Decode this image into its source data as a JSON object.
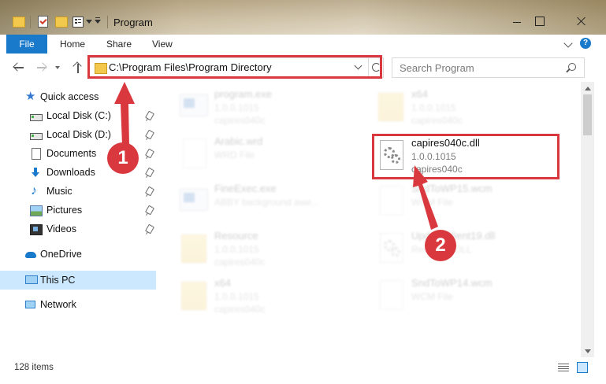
{
  "window": {
    "title": "Program"
  },
  "ribbon": {
    "tabs": [
      {
        "label": "File"
      },
      {
        "label": "Home"
      },
      {
        "label": "Share"
      },
      {
        "label": "View"
      }
    ],
    "help_label": "?"
  },
  "nav": {
    "address": "C:\\Program Files\\Program Directory",
    "search_placeholder": "Search Program"
  },
  "sidebar": {
    "items": [
      {
        "label": "Quick access",
        "icon": "star-icon"
      },
      {
        "label": "Local Disk (C:)",
        "icon": "drive-icon",
        "pinned": true
      },
      {
        "label": "Local Disk (D:)",
        "icon": "drive-icon",
        "pinned": true
      },
      {
        "label": "Documents",
        "icon": "documents-icon",
        "pinned": true
      },
      {
        "label": "Downloads",
        "icon": "download-icon",
        "pinned": true
      },
      {
        "label": "Music",
        "icon": "music-icon",
        "pinned": true
      },
      {
        "label": "Pictures",
        "icon": "pictures-icon",
        "pinned": true
      },
      {
        "label": "Videos",
        "icon": "video-icon",
        "pinned": true
      },
      {
        "label": "OneDrive",
        "icon": "cloud-icon"
      },
      {
        "label": "This PC",
        "icon": "computer-icon",
        "selected": true
      },
      {
        "label": "Network",
        "icon": "network-icon"
      }
    ]
  },
  "files": [
    {
      "name": "program.exe",
      "meta1": "1.0.0.1015",
      "meta2": "capires040c",
      "icon": "exe-icon"
    },
    {
      "name": "x64",
      "meta1": "1.0.0.1015",
      "meta2": "capires040c",
      "icon": "folder-icon"
    },
    {
      "name": "Arabic.wrd",
      "meta1": "WRD File",
      "meta2": "",
      "icon": "document-icon"
    },
    {
      "name": "capires040c.dll",
      "meta1": "1.0.0.1015",
      "meta2": "capires040c",
      "icon": "dll-icon"
    },
    {
      "name": "FineExec.exe",
      "meta1": "ABBY background awe...",
      "meta2": "",
      "icon": "exe-icon"
    },
    {
      "name": "SndToWP15.wcm",
      "meta1": "WCM File",
      "meta2": "",
      "icon": "document-icon"
    },
    {
      "name": "Resource",
      "meta1": "1.0.0.1015",
      "meta2": "capires040c",
      "icon": "folder-icon"
    },
    {
      "name": "UpdateClient19.dll",
      "meta1": "Resource DLL",
      "meta2": "",
      "icon": "dll-icon"
    },
    {
      "name": "x64",
      "meta1": "1.0.0.1015",
      "meta2": "capires040c",
      "icon": "folder-icon"
    },
    {
      "name": "SndToWP14.wcm",
      "meta1": "WCM File",
      "meta2": "",
      "icon": "document-icon"
    }
  ],
  "status": {
    "item_count": "128 items"
  },
  "annotations": {
    "step1": "1",
    "step2": "2",
    "highlight_color": "#d9393e"
  },
  "colors": {
    "accent": "#1979ca",
    "selection": "#cce8ff"
  }
}
